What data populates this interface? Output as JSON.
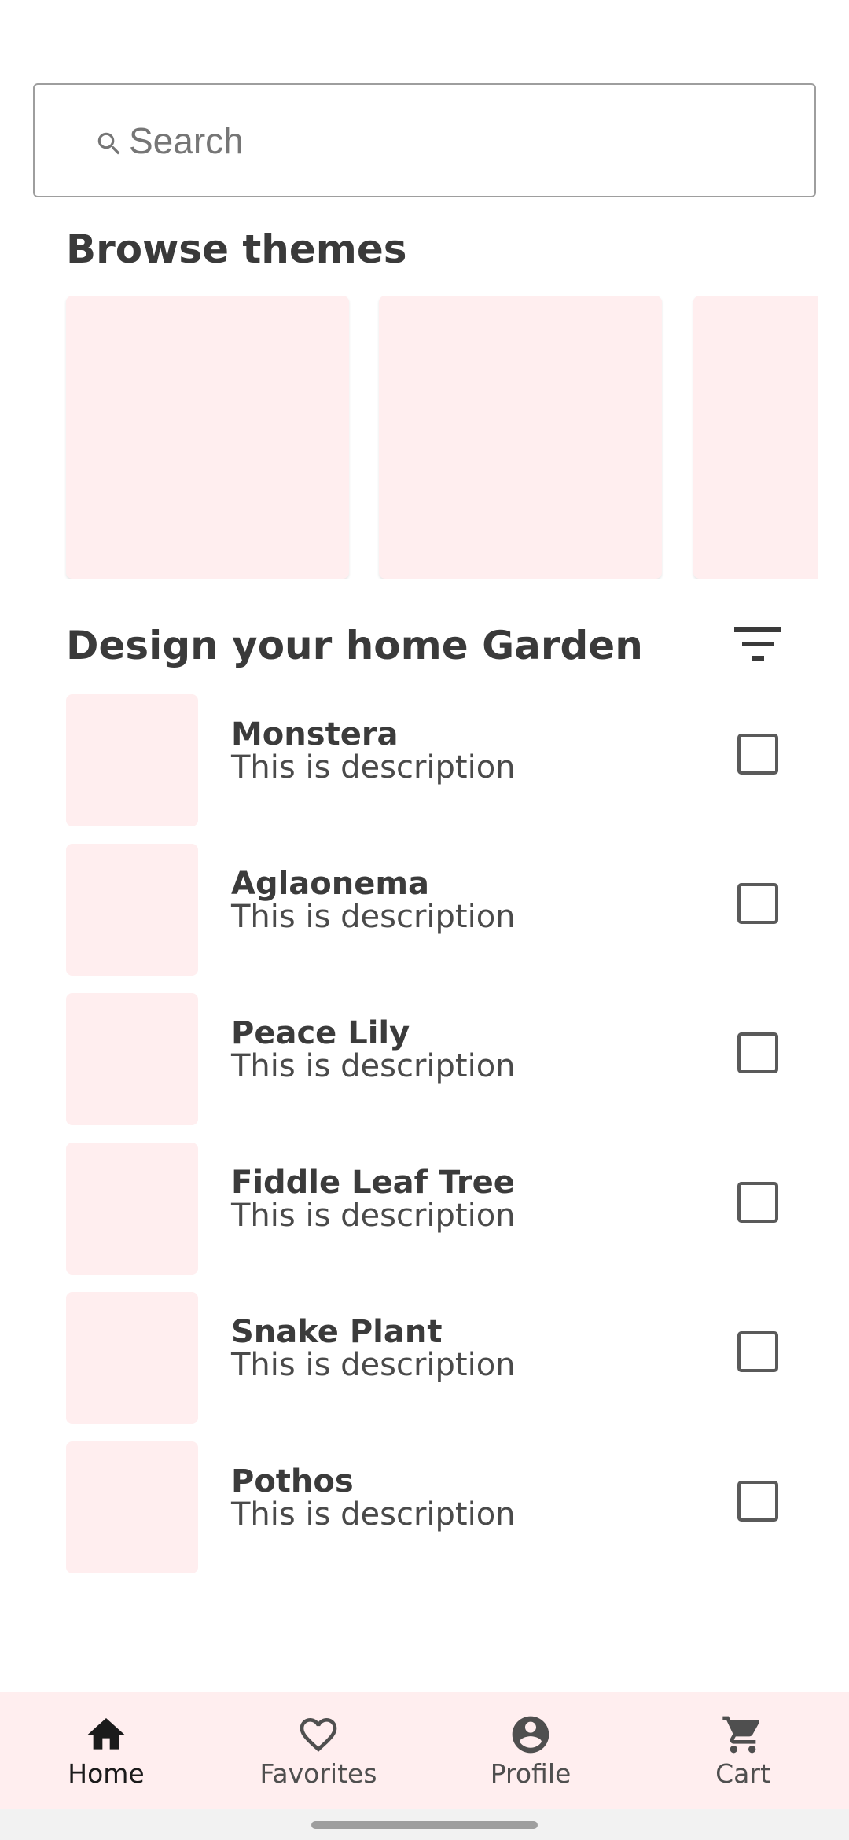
{
  "search": {
    "placeholder": "Search",
    "value": ""
  },
  "browse_themes": {
    "title": "Browse themes",
    "cards": [
      {},
      {},
      {}
    ]
  },
  "garden": {
    "title": "Design your home Garden",
    "plants": [
      {
        "name": "Monstera",
        "description": "This is description",
        "checked": false
      },
      {
        "name": "Aglaonema",
        "description": "This is description",
        "checked": false
      },
      {
        "name": "Peace Lily",
        "description": "This is description",
        "checked": false
      },
      {
        "name": "Fiddle Leaf Tree",
        "description": "This is description",
        "checked": false
      },
      {
        "name": "Snake Plant",
        "description": "This is description",
        "checked": false
      },
      {
        "name": "Pothos",
        "description": "This is description",
        "checked": false
      }
    ]
  },
  "bottom_nav": {
    "active": "Home",
    "items": [
      {
        "label": "Home",
        "icon": "home-icon"
      },
      {
        "label": "Favorites",
        "icon": "heart-icon"
      },
      {
        "label": "Profile",
        "icon": "account-circle-icon"
      },
      {
        "label": "Cart",
        "icon": "cart-icon"
      }
    ]
  },
  "colors": {
    "card_bg": "#FFEEEF",
    "nav_bg": "#FFEEEF",
    "text_primary": "#3A3A3A"
  }
}
